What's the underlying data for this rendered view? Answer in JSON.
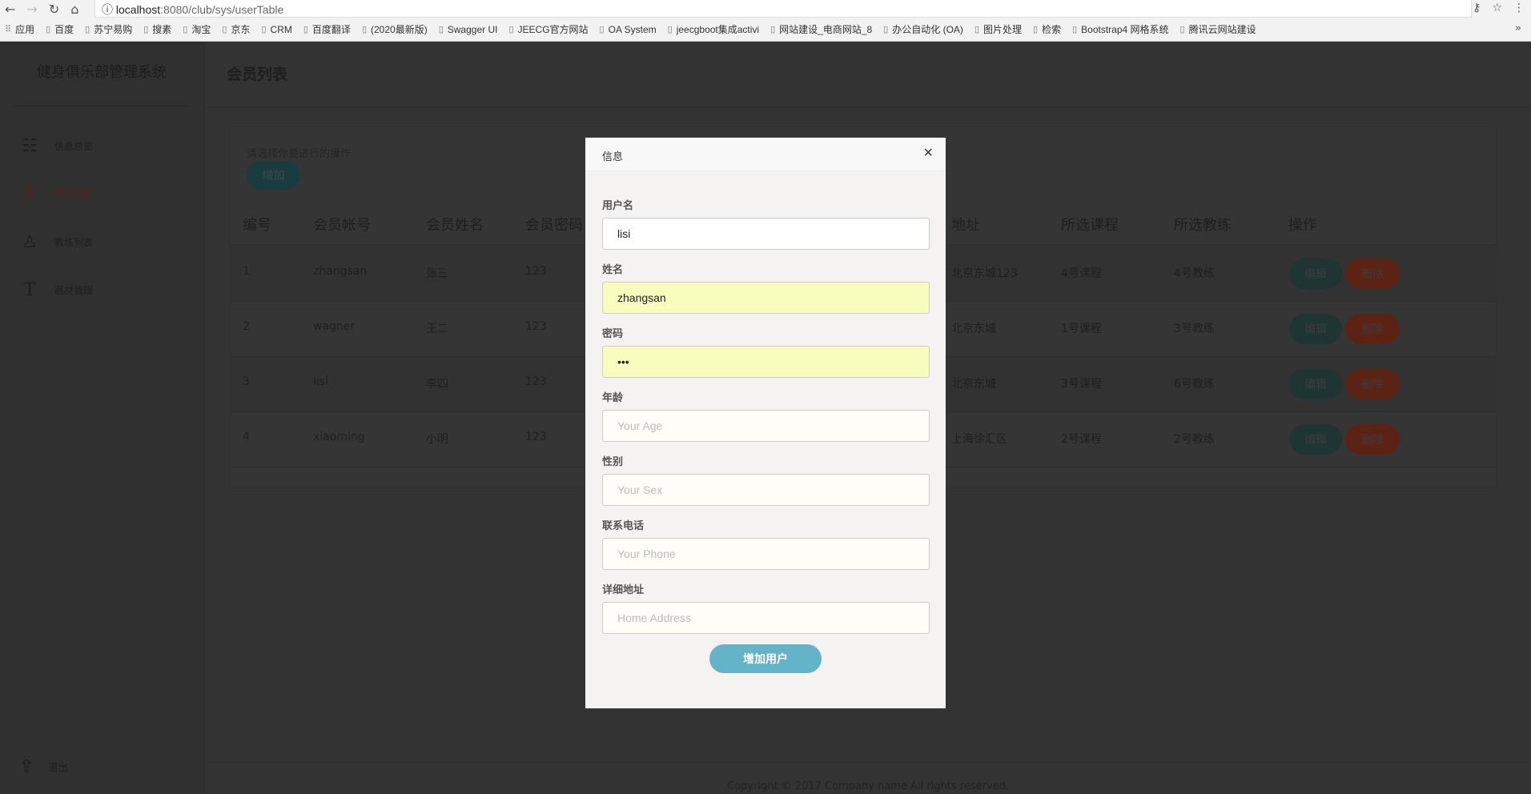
{
  "browser": {
    "url_host": "localhost",
    "url_path": ":8080/club/sys/userTable",
    "bookmarks": [
      "应用",
      "百度",
      "苏宁易购",
      "搜素",
      "淘宝",
      "京东",
      "CRM",
      "百度翻译",
      "(2020最新版)",
      "Swagger UI",
      "JEECG官方网站",
      "OA System",
      "jeecgboot集成activi",
      "网站建设_电商网站_8",
      "办公自动化 (OA)",
      "图片处理",
      "检索",
      "Bootstrap4 网格系统",
      "腾讯云网站建设"
    ],
    "more": "»"
  },
  "sidebar": {
    "brand": "健身俱乐部管理系统",
    "items": [
      {
        "label": "信息总览",
        "icon": "sliders-icon"
      },
      {
        "label": "会员列表",
        "icon": "user-icon",
        "active": true
      },
      {
        "label": "教练列表",
        "icon": "user-icon"
      },
      {
        "label": "器材管理",
        "icon": "text-icon"
      }
    ],
    "logout": "退出"
  },
  "header": {
    "title": "会员列表"
  },
  "panel": {
    "hint": "请选择你要进行的操作",
    "add_label": "增加"
  },
  "table": {
    "columns": [
      "编号",
      "会员帐号",
      "会员姓名",
      "会员密码",
      "地址",
      "所选课程",
      "所选教练",
      "操作"
    ],
    "rows": [
      [
        "1",
        "zhangsan",
        "张三",
        "123",
        "北京东城123",
        "4号课程",
        "4号教练"
      ],
      [
        "2",
        "wagner",
        "王二",
        "123",
        "北京东城",
        "1号课程",
        "3号教练"
      ],
      [
        "3",
        "lisi",
        "李四",
        "123",
        "北京东城",
        "3号课程",
        "6号教练"
      ],
      [
        "4",
        "xiaoming",
        "小明",
        "123",
        "上海徐汇区",
        "2号课程",
        "2号教练"
      ]
    ],
    "edit_label": "编辑",
    "delete_label": "删除"
  },
  "footer": "Copyright © 2017 Company name All rights reserved.",
  "modal": {
    "title": "信息",
    "close": "×",
    "fields": [
      {
        "label": "用户名",
        "value": "lisi",
        "placeholder": ""
      },
      {
        "label": "姓名",
        "value": "zhangsan",
        "placeholder": ""
      },
      {
        "label": "密码",
        "value": "123",
        "placeholder": ""
      },
      {
        "label": "年龄",
        "value": "",
        "placeholder": "Your Age"
      },
      {
        "label": "性别",
        "value": "",
        "placeholder": "Your Sex"
      },
      {
        "label": "联系电话",
        "value": "",
        "placeholder": "Your Phone"
      },
      {
        "label": "详细地址",
        "value": "",
        "placeholder": "Home Address"
      }
    ],
    "submit_label": "增加用户"
  }
}
